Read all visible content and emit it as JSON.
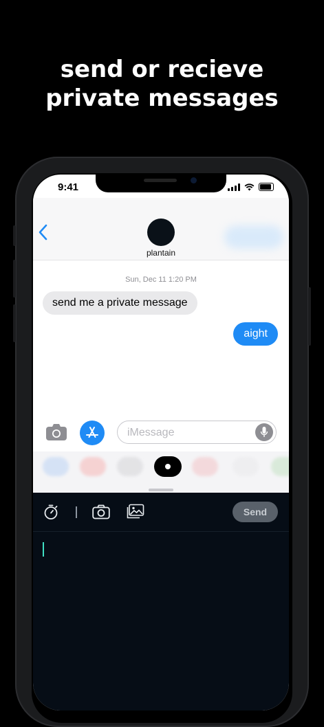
{
  "headline": [
    "send or recieve",
    "private messages"
  ],
  "status_bar": {
    "time": "9:41"
  },
  "conversation": {
    "contact_name": "plantain",
    "timestamp": "Sun, Dec 11 1:20 PM",
    "messages": [
      {
        "direction": "incoming",
        "text": "send me a private message"
      },
      {
        "direction": "outgoing",
        "text": "aight"
      }
    ]
  },
  "compose": {
    "placeholder": "iMessage"
  },
  "app_drawer": {
    "apps": [
      {
        "name": "app-store-blurred",
        "color": "#c9dbf5"
      },
      {
        "name": "red-app-blurred",
        "color": "#f6c4c4"
      },
      {
        "name": "apple-pay-blurred",
        "color": "#dcdcdf"
      },
      {
        "name": "private-message-app",
        "color": "#000000",
        "selected": true
      },
      {
        "name": "pink-app-blurred",
        "color": "#f3cfd2"
      },
      {
        "name": "white-app-blurred",
        "color": "#ececee"
      },
      {
        "name": "green-app-blurred",
        "color": "#cfe6cf"
      }
    ]
  },
  "extension": {
    "send_label": "Send",
    "tools": [
      "timer-icon",
      "camera-icon",
      "photo-library-icon"
    ]
  },
  "colors": {
    "accent_blue": "#1f8bf5",
    "panel_bg": "#060d16",
    "cursor": "#3fe0c4"
  }
}
